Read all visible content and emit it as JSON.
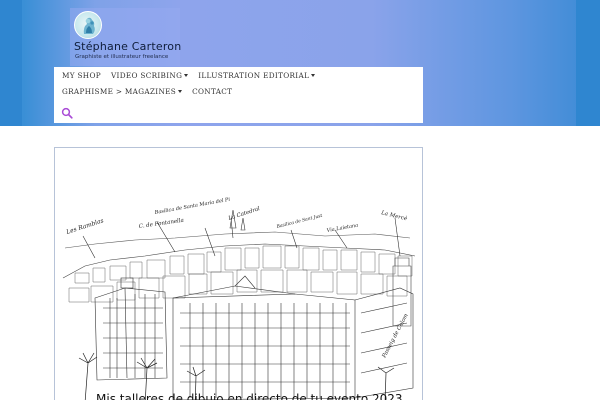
{
  "site": {
    "title": "Stéphane Carteron",
    "tagline": "Graphiste et illustrateur freelance",
    "logo_icon": "vase-logo-icon"
  },
  "colors": {
    "header_gradient_mid": "#8ea4ec",
    "header_edge": "#2f86d0",
    "nav_bg": "#ffffff",
    "search_icon": "#a94bd6",
    "card_border": "#b7c3d8"
  },
  "nav": {
    "items": [
      {
        "label": "MY SHOP",
        "has_submenu": false
      },
      {
        "label": "VIDEO SCRIBING",
        "has_submenu": true
      },
      {
        "label": "ILLUSTRATION EDITORIAL",
        "has_submenu": true
      },
      {
        "label": "GRAPHISME > MAGAZINES",
        "has_submenu": true
      },
      {
        "label": "CONTACT",
        "has_submenu": false
      }
    ],
    "search_icon": "search-icon"
  },
  "post": {
    "image_labels": [
      "Les Ramblas",
      "Basilica de Santa Maria del Pi",
      "C. de Fontanella",
      "La Catedral",
      "Basilica de Sant Just",
      "Via Laietana",
      "La Mercè",
      "Passeig de Colom"
    ],
    "title_visible": "Mis talleres de dibujo en directo de tu evento 2023"
  }
}
